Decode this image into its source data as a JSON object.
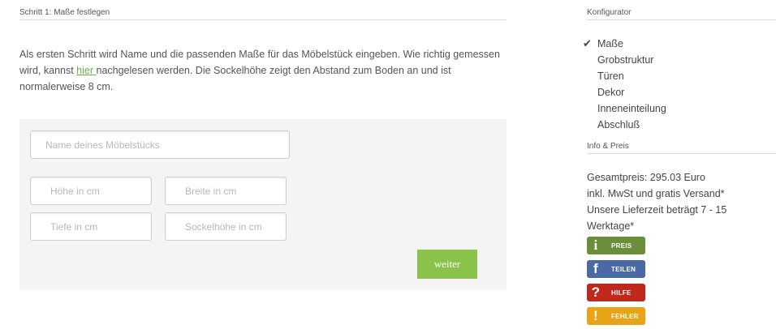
{
  "step": {
    "title": "Schritt 1: Maße festlegen"
  },
  "intro": {
    "text_before": "Als ersten Schritt wird Name und die passenden Maße für das Möbelstück eingeben. Wie richtig gemessen wird, kannst ",
    "link": "hier ",
    "text_after": "nachgelesen werden. Die Sockelhöhe zeigt den Abstand zum Boden an und ist normalerweise 8 cm."
  },
  "form": {
    "name_placeholder": "Name deines Möbelstücks",
    "hoehe_placeholder": "Höhe in cm",
    "breite_placeholder": "Breite in cm",
    "tiefe_placeholder": "Tiefe in cm",
    "sockel_placeholder": "Sockelhöhe in cm",
    "submit_label": "weiter",
    "submit_color": "#8bc34a"
  },
  "sidebar": {
    "konfigurator_title": "Konfigurator",
    "items": [
      {
        "label": "Maße",
        "checked": true
      },
      {
        "label": "Grobstruktur"
      },
      {
        "label": "Türen"
      },
      {
        "label": "Dekor"
      },
      {
        "label": "Inneneinteilung"
      },
      {
        "label": "Abschluß"
      }
    ],
    "info_title": "Info & Preis",
    "price_line": "Gesamtpreis: 295.03 Euro",
    "tax_line": "inkl. MwSt und gratis Versand*",
    "delivery_line": "Unsere Lieferzeit beträgt 7 - 15 Werktage*"
  },
  "badges": [
    {
      "label": "PREIS",
      "icon": "info-icon",
      "glyph": "i",
      "color": "#6b8e3a"
    },
    {
      "label": "TEILEN",
      "icon": "facebook-icon",
      "glyph": "f",
      "color": "#4a6aa5"
    },
    {
      "label": "HILFE",
      "icon": "question-icon",
      "glyph": "?",
      "color": "#c0281c"
    },
    {
      "label": "FEHLER",
      "icon": "exclamation-icon",
      "glyph": "!",
      "color": "#e8a317"
    }
  ]
}
